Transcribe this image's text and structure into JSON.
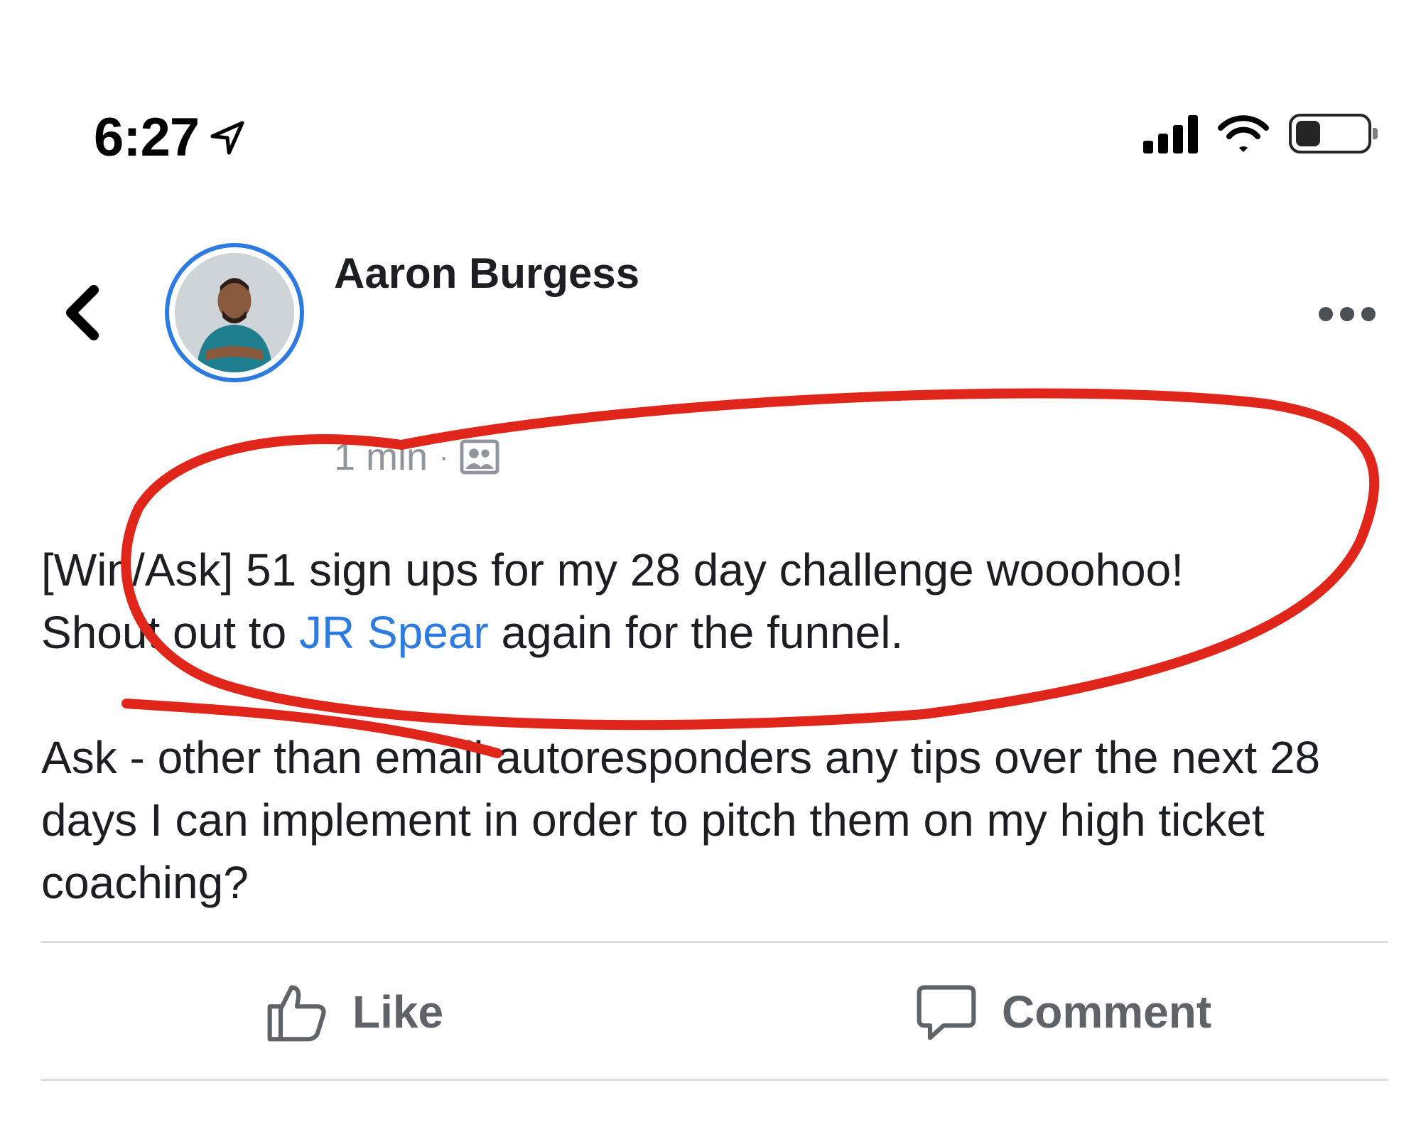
{
  "status_bar": {
    "time": "6:27",
    "icons": [
      "location-arrow-icon",
      "cellular-signal-icon",
      "wifi-icon",
      "battery-icon"
    ],
    "signal_bars": 4,
    "battery_level": 0.35
  },
  "post": {
    "author": "Aaron Burgess",
    "timestamp": "1 min",
    "separator": "·",
    "privacy_icon": "group-members-icon",
    "line1": "[Win/Ask] 51 sign ups for my 28 day challenge wooohoo!",
    "line2_before": "Shout out to ",
    "mention": "JR Spear",
    "line2_after": " again for the funnel.",
    "para2": "Ask - other than email autoresponders any tips over the next 28 days I can implement in order to pitch them on my high ticket coaching?"
  },
  "actions": {
    "like_label": "Like",
    "comment_label": "Comment"
  },
  "colors": {
    "accent": "#2d7be0",
    "annotation": "#e0261a",
    "muted": "#90949c"
  }
}
